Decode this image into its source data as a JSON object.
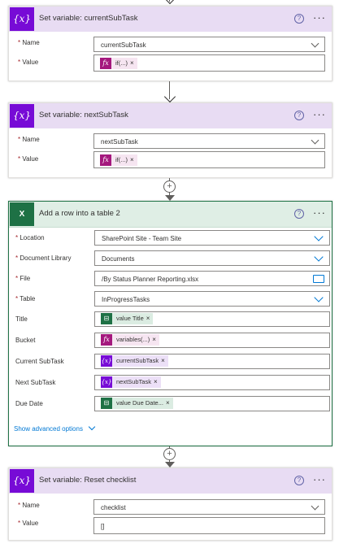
{
  "cards": [
    {
      "title": "Set variable: currentSubTask",
      "icon": "{x}",
      "fields": [
        {
          "label": "Name",
          "required": "*",
          "value": "currentSubTask"
        },
        {
          "label": "Value",
          "required": "*",
          "token_icon": "fx",
          "token": "if(...)",
          "token_close": "×"
        }
      ]
    },
    {
      "title": "Set variable: nextSubTask",
      "icon": "{x}",
      "fields": [
        {
          "label": "Name",
          "required": "*",
          "value": "nextSubTask"
        },
        {
          "label": "Value",
          "required": "*",
          "token_icon": "fx",
          "token": "if(...)",
          "token_close": "×"
        }
      ]
    },
    {
      "title": "Add a row into a table 2",
      "icon": "X",
      "fields": [
        {
          "label": "Location",
          "required": "*",
          "value": "SharePoint Site - Team Site"
        },
        {
          "label": "Document Library",
          "required": "*",
          "value": "Documents"
        },
        {
          "label": "File",
          "required": "*",
          "value": "/By Status Planner Reporting.xlsx"
        },
        {
          "label": "Table",
          "required": "*",
          "value": "InProgressTasks"
        },
        {
          "label": "Title",
          "token_icon": "⊟",
          "token": "value Title",
          "token_close": "×"
        },
        {
          "label": "Bucket",
          "token_icon": "fx",
          "token": "variables(...)",
          "token_close": "×"
        },
        {
          "label": "Current SubTask",
          "token_icon": "{x}",
          "token": "currentSubTask",
          "token_close": "×"
        },
        {
          "label": "Next SubTask",
          "token_icon": "{x}",
          "token": "nextSubTask",
          "token_close": "×"
        },
        {
          "label": "Due Date",
          "token_icon": "⊟",
          "token": "value Due Date...",
          "token_close": "×"
        }
      ],
      "advanced_link": "Show advanced options"
    },
    {
      "title": "Set variable: Reset checklist",
      "icon": "{x}",
      "fields": [
        {
          "label": "Name",
          "required": "*",
          "value": "checklist"
        },
        {
          "label": "Value",
          "required": "*",
          "value": "[]"
        }
      ]
    }
  ],
  "help_glyph": "?",
  "more_glyph": "···",
  "plus_glyph": "+",
  "colors": {
    "variable": "#770bd6",
    "excel": "#1e7145",
    "expression": "#a4187d",
    "link": "#0078d4"
  }
}
